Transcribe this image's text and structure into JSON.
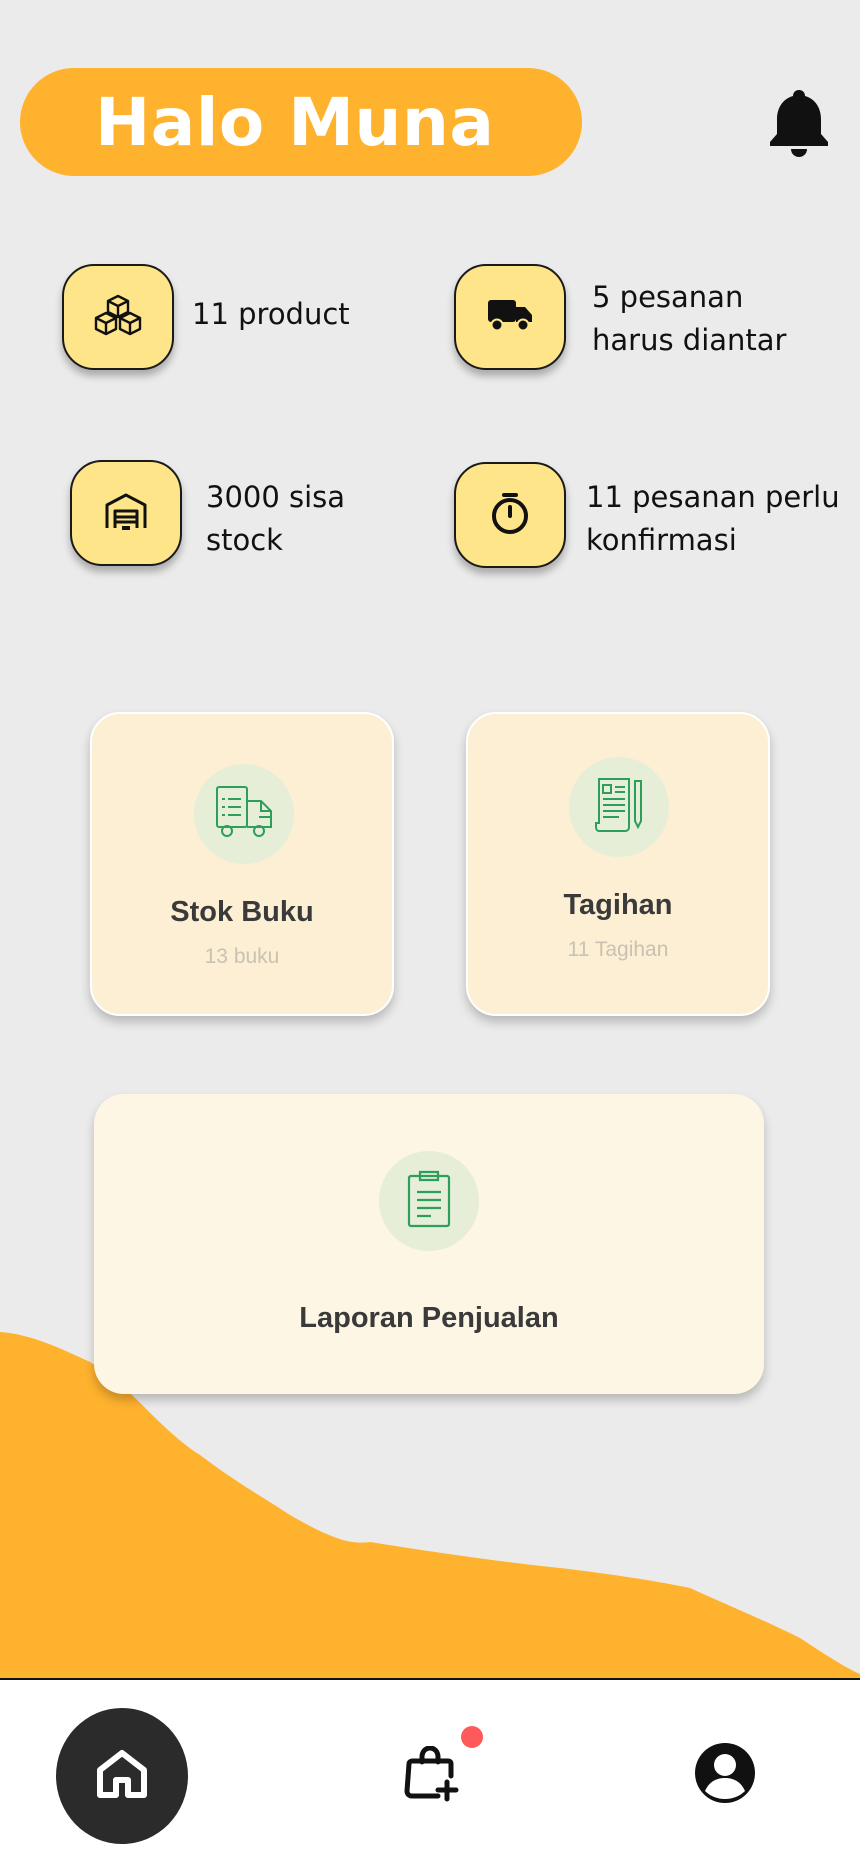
{
  "header": {
    "greeting": "Halo Muna"
  },
  "stats": [
    {
      "icon": "boxes-icon",
      "line1": "11 product",
      "line2": ""
    },
    {
      "icon": "truck-icon",
      "line1": "5 pesanan",
      "line2": "harus diantar"
    },
    {
      "icon": "warehouse-icon",
      "line1": "3000 sisa",
      "line2": "stock"
    },
    {
      "icon": "stopwatch-icon",
      "line1": "11 pesanan perlu",
      "line2": "konfirmasi"
    }
  ],
  "cards": {
    "stock": {
      "title": "Stok Buku",
      "subtitle": "13 buku"
    },
    "invoice": {
      "title": "Tagihan",
      "subtitle": "11 Tagihan"
    },
    "report": {
      "title": "Laporan Penjualan"
    }
  },
  "nav": {
    "items": [
      "home-icon",
      "shopping-bag-add-icon",
      "profile-icon"
    ],
    "notification_dot": true
  },
  "colors": {
    "accent": "#ffb22e",
    "stat_icon_bg": "#ffe589",
    "card_bg": "#fcefd3",
    "icon_green": "#2e9e5b",
    "badge": "#ff5a5a"
  }
}
